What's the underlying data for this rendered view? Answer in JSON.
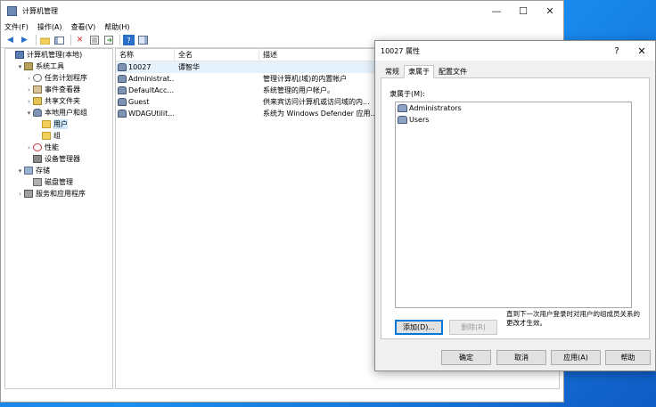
{
  "window": {
    "title": "计算机管理"
  },
  "menu": [
    "文件(F)",
    "操作(A)",
    "查看(V)",
    "帮助(H)"
  ],
  "tree": [
    {
      "label": "计算机管理(本地)",
      "level": 0,
      "icon": "computer-icon",
      "expand": "",
      "key": "root"
    },
    {
      "label": "系统工具",
      "level": 1,
      "icon": "tools-icon",
      "expand": "▾",
      "key": "system-tools"
    },
    {
      "label": "任务计划程序",
      "level": 2,
      "icon": "clock-icon",
      "expand": "›",
      "key": "task-scheduler"
    },
    {
      "label": "事件查看器",
      "level": 2,
      "icon": "event-icon",
      "expand": "›",
      "key": "event-viewer"
    },
    {
      "label": "共享文件夹",
      "level": 2,
      "icon": "share-icon",
      "expand": "›",
      "key": "shared-folders"
    },
    {
      "label": "本地用户和组",
      "level": 2,
      "icon": "users-icon",
      "expand": "▾",
      "key": "local-users-groups"
    },
    {
      "label": "用户",
      "level": 3,
      "icon": "folder-icon",
      "expand": "",
      "key": "users",
      "selected": true
    },
    {
      "label": "组",
      "level": 3,
      "icon": "folder-icon",
      "expand": "",
      "key": "groups"
    },
    {
      "label": "性能",
      "level": 2,
      "icon": "performance-icon",
      "expand": "›",
      "key": "performance"
    },
    {
      "label": "设备管理器",
      "level": 2,
      "icon": "device-icon",
      "expand": "",
      "key": "device-manager"
    },
    {
      "label": "存储",
      "level": 1,
      "icon": "storage-icon",
      "expand": "▾",
      "key": "storage"
    },
    {
      "label": "磁盘管理",
      "level": 2,
      "icon": "disk-icon",
      "expand": "",
      "key": "disk-management"
    },
    {
      "label": "服务和应用程序",
      "level": 1,
      "icon": "services-icon",
      "expand": "›",
      "key": "services-apps"
    }
  ],
  "list": {
    "columns": [
      "名称",
      "全名",
      "描述"
    ],
    "rows": [
      {
        "name": "10027",
        "fullname": "谭智华",
        "desc": "",
        "selected": true
      },
      {
        "name": "Administrat...",
        "fullname": "",
        "desc": "管理计算机(域)的内置帐户"
      },
      {
        "name": "DefaultAcc...",
        "fullname": "",
        "desc": "系统管理的用户帐户。"
      },
      {
        "name": "Guest",
        "fullname": "",
        "desc": "供来宾访问计算机或访问域的内..."
      },
      {
        "name": "WDAGUtilit...",
        "fullname": "",
        "desc": "系统为 Windows Defender 应用..."
      }
    ]
  },
  "dialog": {
    "title": "10027 属性",
    "help_glyph": "?",
    "close_glyph": "✕",
    "tabs": [
      "常规",
      "隶属于",
      "配置文件"
    ],
    "active_tab": 1,
    "member_of_label": "隶属于(M):",
    "members": [
      "Administrators",
      "Users"
    ],
    "add_button": "添加(D)...",
    "remove_button": "删除(R)",
    "note": "直到下一次用户登录时对用户的组成员关系的更改才生效。",
    "ok_button": "确定",
    "cancel_button": "取消",
    "apply_button": "应用(A)",
    "help_button": "帮助"
  }
}
